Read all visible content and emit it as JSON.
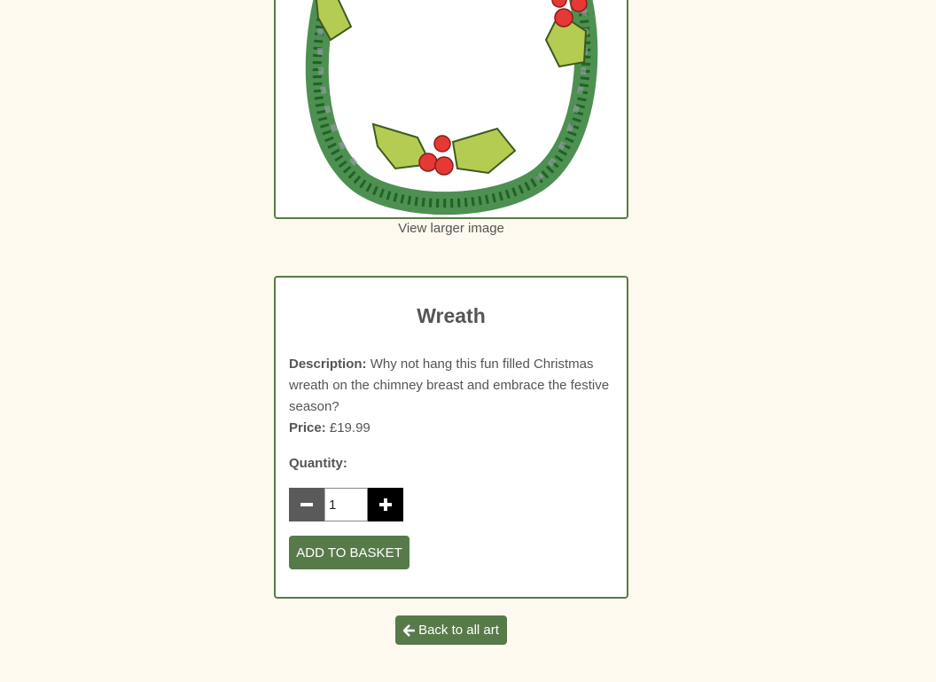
{
  "image_link_label": "View larger image",
  "product": {
    "title": "Wreath",
    "description_label": "Description:",
    "description_text": "Why not hang this fun filled Christmas wreath on the chimney breast and embrace the festive season?",
    "price_label": "Price:",
    "price_value": "£19.99",
    "quantity_label": "Quantity:",
    "quantity_value": "1",
    "add_to_basket_label": "ADD TO BASKET"
  },
  "back_button_label": "Back to all art",
  "colors": {
    "background": "#fef9ee",
    "accent_green": "#577a49",
    "minus_button": "#5a5a5a",
    "plus_button": "#000000",
    "text": "#555555"
  },
  "icons": {
    "minus": "minus-icon",
    "plus": "plus-icon",
    "back": "arrow-left-icon"
  }
}
